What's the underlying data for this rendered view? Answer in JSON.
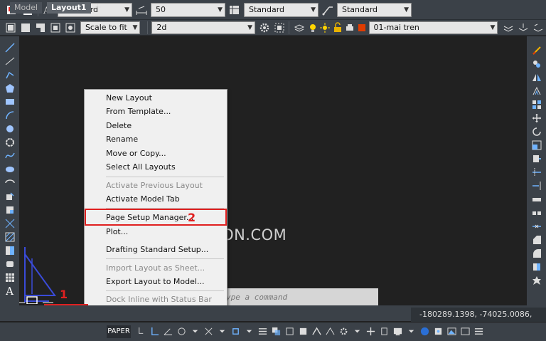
{
  "toolbar1": {
    "text_style": "Standard",
    "dim_scale": "50",
    "table_style": "Standard",
    "multileader_style": "Standard"
  },
  "toolbar2": {
    "viewport_scale": "Scale to fit",
    "layer_state": "2d",
    "layer": "01-mai tren",
    "layer_color": "#e03c00"
  },
  "context_menu": {
    "items": [
      {
        "label": "New Layout",
        "disabled": false
      },
      {
        "label": "From Template...",
        "disabled": false
      },
      {
        "label": "Delete",
        "disabled": false
      },
      {
        "label": "Rename",
        "disabled": false
      },
      {
        "label": "Move or Copy...",
        "disabled": false
      },
      {
        "label": "Select All Layouts",
        "disabled": false
      },
      {
        "label": "Activate Previous Layout",
        "disabled": true
      },
      {
        "label": "Activate Model Tab",
        "disabled": false
      },
      {
        "label": "Page Setup Manager...",
        "disabled": false
      },
      {
        "label": "Plot...",
        "disabled": false
      },
      {
        "label": "Drafting Standard Setup...",
        "disabled": false
      },
      {
        "label": "Import Layout as Sheet...",
        "disabled": true
      },
      {
        "label": "Export Layout to Model...",
        "disabled": false
      },
      {
        "label": "Dock Inline with Status Bar",
        "disabled": true
      }
    ]
  },
  "annotations": {
    "step1": "1",
    "step2": "2",
    "color": "#e02020"
  },
  "watermark": "DOHOASAIGON.COM",
  "command_line": {
    "placeholder": "ype a command"
  },
  "tabs": {
    "model": "Model",
    "layout": "Layout1",
    "add": "+"
  },
  "status": {
    "coordinates": "-180289.1398, -74025.0086, 0.0000",
    "space": "PAPER"
  }
}
